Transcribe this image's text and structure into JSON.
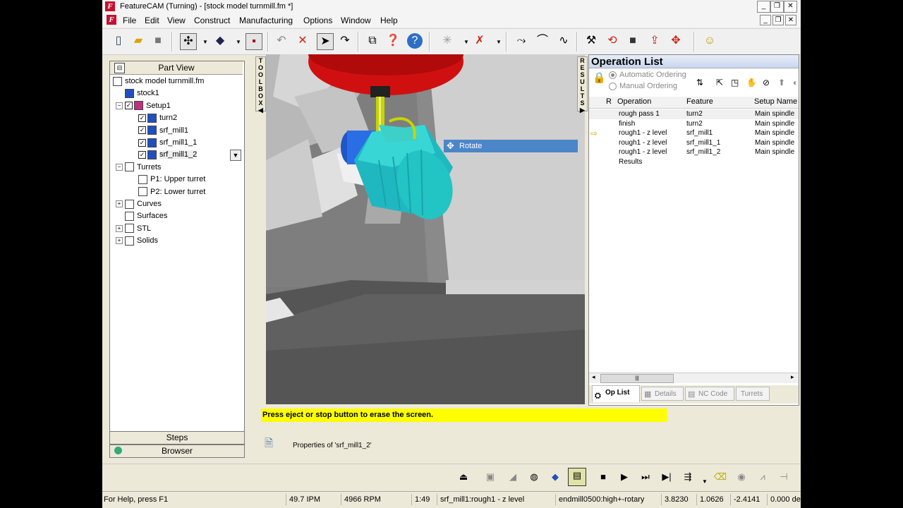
{
  "window": {
    "title": "FeatureCAM (Turning) - [stock model turnmill.fm *]",
    "app_icon": "F",
    "controls": [
      "minimize-icon",
      "maximize-icon",
      "close-icon"
    ]
  },
  "menu": {
    "items": [
      "File",
      "Edit",
      "View",
      "Construct",
      "Manufacturing",
      "Options",
      "Window",
      "Help"
    ]
  },
  "left_pane": {
    "header": "Part View",
    "tree": [
      {
        "label": "stock model turnmill.fm",
        "level": 0,
        "icon": "document-icon"
      },
      {
        "label": "stock1",
        "level": 1,
        "icon": "stock-icon"
      },
      {
        "label": "Setup1",
        "level": 1,
        "icon": "setup-icon",
        "expander": "−",
        "checked": true
      },
      {
        "label": "turn2",
        "level": 2,
        "icon": "feature-icon",
        "checked": true
      },
      {
        "label": "srf_mill1",
        "level": 2,
        "icon": "feature-icon",
        "checked": true
      },
      {
        "label": "srf_mill1_1",
        "level": 2,
        "icon": "feature-icon",
        "checked": true
      },
      {
        "label": "srf_mill1_2",
        "level": 2,
        "icon": "feature-icon",
        "checked": true,
        "selected": true
      },
      {
        "label": "Turrets",
        "level": 1,
        "icon": "turret-icon",
        "expander": "−"
      },
      {
        "label": "P1: Upper turret",
        "level": 2,
        "icon": "turret-icon"
      },
      {
        "label": "P2: Lower turret",
        "level": 2,
        "icon": "turret-icon"
      },
      {
        "label": "Curves",
        "level": 1,
        "icon": "curve-icon",
        "expander": "+"
      },
      {
        "label": "Surfaces",
        "level": 1,
        "icon": "surface-icon"
      },
      {
        "label": "STL",
        "level": 1,
        "icon": "stl-icon",
        "expander": "+"
      },
      {
        "label": "Solids",
        "level": 1,
        "icon": "solid-icon",
        "expander": "+"
      }
    ],
    "steps": "Steps",
    "browser": "Browser"
  },
  "toolbox_label": "TOOLBOX",
  "results_label": "RESULTS",
  "viewport": {
    "rotate_label": "Rotate"
  },
  "message": "Press eject or stop button to erase the screen.",
  "properties": "Properties of 'srf_mill1_2'",
  "op_list": {
    "title": "Operation List",
    "ordering": [
      "Automatic Ordering",
      "Manual Ordering"
    ],
    "columns": [
      "R",
      "Operation",
      "Feature",
      "Setup Name"
    ],
    "rows": [
      {
        "op": "rough pass 1",
        "feature": "turn2",
        "setup": "Main spindle",
        "current": false
      },
      {
        "op": "finish",
        "feature": "turn2",
        "setup": "Main spindle",
        "current": false
      },
      {
        "op": "rough1 - z level",
        "feature": "srf_mill1",
        "setup": "Main spindle",
        "current": true
      },
      {
        "op": "rough1 - z level",
        "feature": "srf_mill1_1",
        "setup": "Main spindle",
        "current": false
      },
      {
        "op": "rough1 - z level",
        "feature": "srf_mill1_2",
        "setup": "Main spindle",
        "current": false
      },
      {
        "op": "Results",
        "feature": "",
        "setup": "",
        "current": false
      }
    ],
    "tabs": [
      "Op List",
      "Details",
      "NC Code",
      "Turrets"
    ]
  },
  "status": {
    "help": "For Help, press F1",
    "feed": "49.7 IPM",
    "speed": "4966 RPM",
    "time": "1:49",
    "operation": "srf_mill1:rough1 - z level",
    "tool": "endmill0500:high+-rotary",
    "x": "3.8230",
    "y": "1.0626",
    "z": "-2.4141",
    "angle": "0.000 de"
  },
  "colors": {
    "message_bg": "#ffff00",
    "rotate_bg": "#4a86c8",
    "part": "#22c4c4",
    "spindle": "#d01010"
  }
}
